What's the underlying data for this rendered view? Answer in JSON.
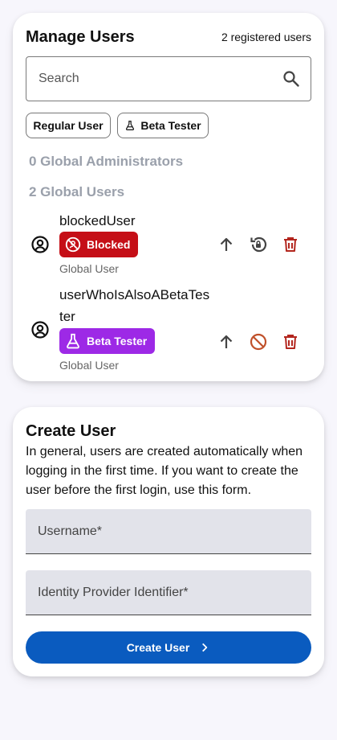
{
  "manage": {
    "title": "Manage Users",
    "count_text": "2 registered users",
    "search": {
      "placeholder": "Search",
      "value": ""
    },
    "filters": [
      {
        "label": "Regular User"
      },
      {
        "label": "Beta Tester",
        "icon": "flask-icon"
      }
    ],
    "sections": {
      "admins": "0 Global Administrators",
      "users": "2 Global Users"
    },
    "users": [
      {
        "name": "blockedUser",
        "badge": "Blocked",
        "badge_icon": "blocked-icon",
        "subtitle": "Global User",
        "actions": [
          "promote-icon",
          "restore-lock-icon",
          "delete-icon"
        ]
      },
      {
        "name": "userWhoIsAlsoABetaTester",
        "badge": "Beta Tester",
        "badge_icon": "flask-icon",
        "subtitle": "Global User",
        "actions": [
          "promote-icon",
          "block-icon",
          "delete-icon"
        ]
      }
    ]
  },
  "create": {
    "title": "Create User",
    "description": "In general, users are created automatically when logging in the first time. If you want to create the user before the first login, use this form.",
    "username_placeholder": "Username*",
    "idp_placeholder": "Identity Provider Identifier*",
    "button_label": "Create User"
  },
  "colors": {
    "primary": "#0a5bbf",
    "blocked_badge": "#c50f17",
    "beta_badge": "#9d29e6",
    "delete": "#b3261e",
    "block_action": "#c0502a",
    "section_head": "#9aa0ab",
    "background": "#f7f6fc"
  }
}
